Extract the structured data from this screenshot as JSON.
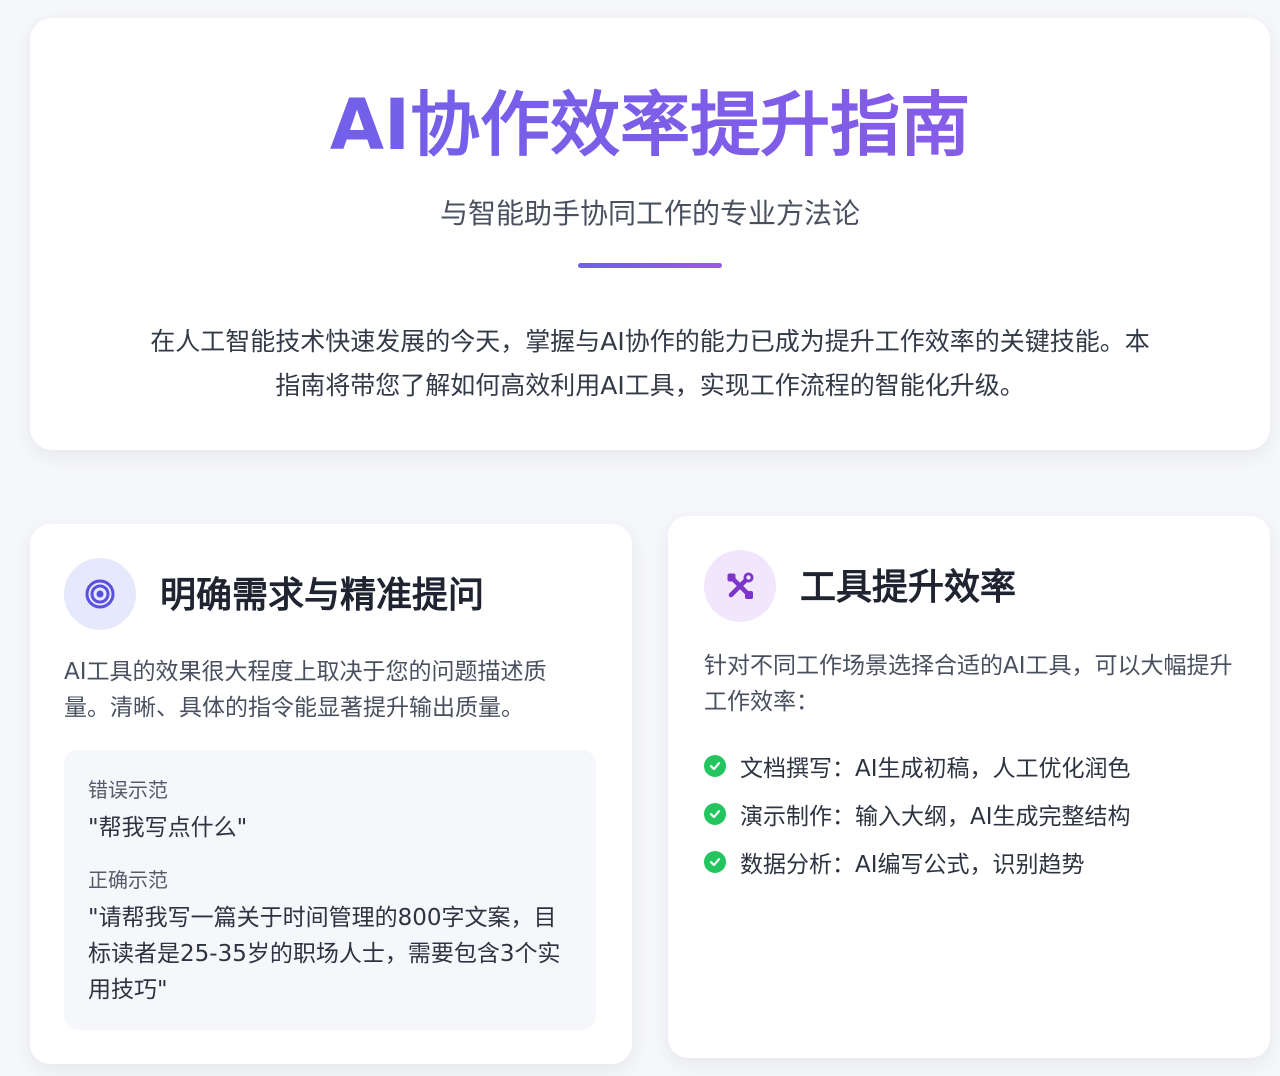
{
  "hero": {
    "title": "AI协作效率提升指南",
    "subtitle": "与智能助手协同工作的专业方法论",
    "intro": "在人工智能技术快速发展的今天，掌握与AI协作的能力已成为提升工作效率的关键技能。本指南将带您了解如何高效利用AI工具，实现工作流程的智能化升级。"
  },
  "cards": [
    {
      "icon": "target-icon",
      "title": "明确需求与精准提问",
      "description": "AI工具的效果很大程度上取决于您的问题描述质量。清晰、具体的指令能显著提升输出质量。",
      "examples": {
        "wrong_label": "错误示范",
        "wrong_text": "\"帮我写点什么\"",
        "right_label": "正确示范",
        "right_text": "\"请帮我写一篇关于时间管理的800字文案，目标读者是25-35岁的职场人士，需要包含3个实用技巧\""
      }
    },
    {
      "icon": "tools-icon",
      "title": "工具提升效率",
      "description": "针对不同工作场景选择合适的AI工具，可以大幅提升工作效率：",
      "features": [
        "文档撰写：AI生成初稿，人工优化润色",
        "演示制作：输入大纲，AI生成完整结构",
        "数据分析：AI编写公式，识别趋势"
      ]
    }
  ],
  "colors": {
    "accent_blue": "#6a61ea",
    "accent_purple": "#9b59e6",
    "check_green": "#22c55e",
    "page_bg": "#f6f7fa"
  }
}
